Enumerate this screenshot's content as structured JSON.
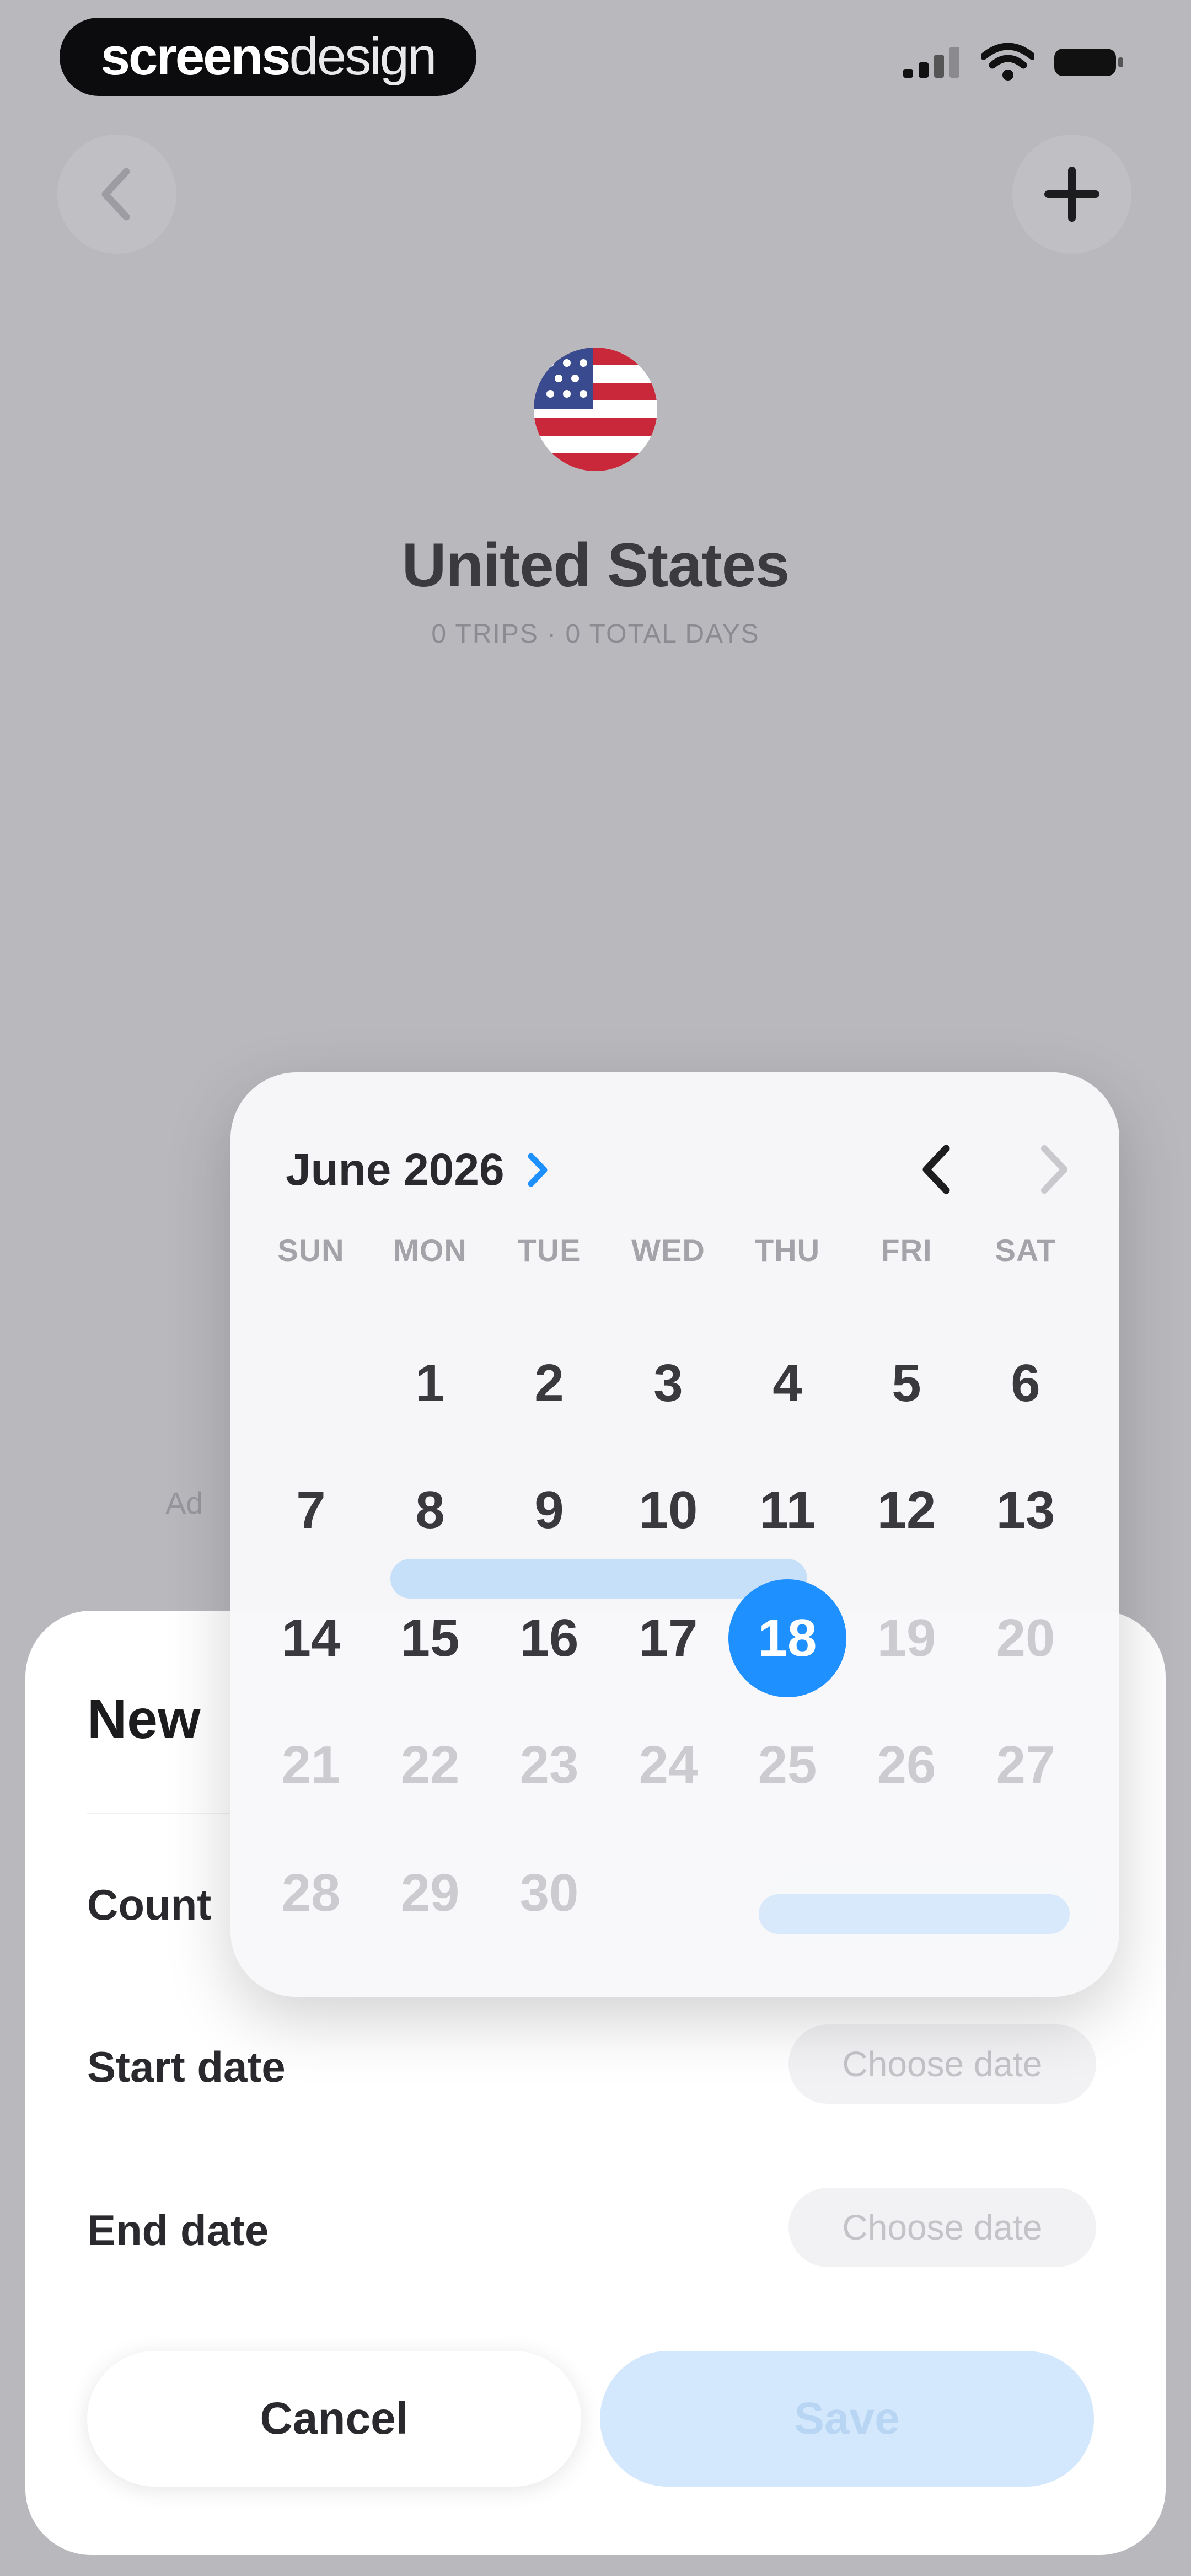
{
  "status_bar": {
    "brand_part1": "screens",
    "brand_part2": "design"
  },
  "header": {
    "back_icon": "chevron-left-icon",
    "add_icon": "plus-icon",
    "flag_icon": "us-flag-icon"
  },
  "country": {
    "title": "United States",
    "subtitle": "0 TRIPS · 0 TOTAL DAYS"
  },
  "peek_text": "Ad",
  "sheet": {
    "title": "New",
    "country_label": "Count",
    "start_label": "Start date",
    "start_value": "Choose date",
    "end_label": "End date",
    "end_value": "Choose date",
    "cancel_label": "Cancel",
    "save_label": "Save"
  },
  "calendar": {
    "month_label": "June 2026",
    "weekdays": [
      "SUN",
      "MON",
      "TUE",
      "WED",
      "THU",
      "FRI",
      "SAT"
    ],
    "selected_day": 18,
    "weeks": [
      [
        "",
        "1",
        "2",
        "3",
        "4",
        "5",
        "6"
      ],
      [
        "7",
        "8",
        "9",
        "10",
        "11",
        "12",
        "13"
      ],
      [
        "14",
        "15",
        "16",
        "17",
        "18",
        "19",
        "20"
      ],
      [
        "21",
        "22",
        "23",
        "24",
        "25",
        "26",
        "27"
      ],
      [
        "28",
        "29",
        "30",
        "",
        "",
        "",
        ""
      ]
    ]
  },
  "colors": {
    "accent": "#1e90ff",
    "save_bg": "#d3e8fc",
    "backdrop": "#b9b8bd"
  }
}
